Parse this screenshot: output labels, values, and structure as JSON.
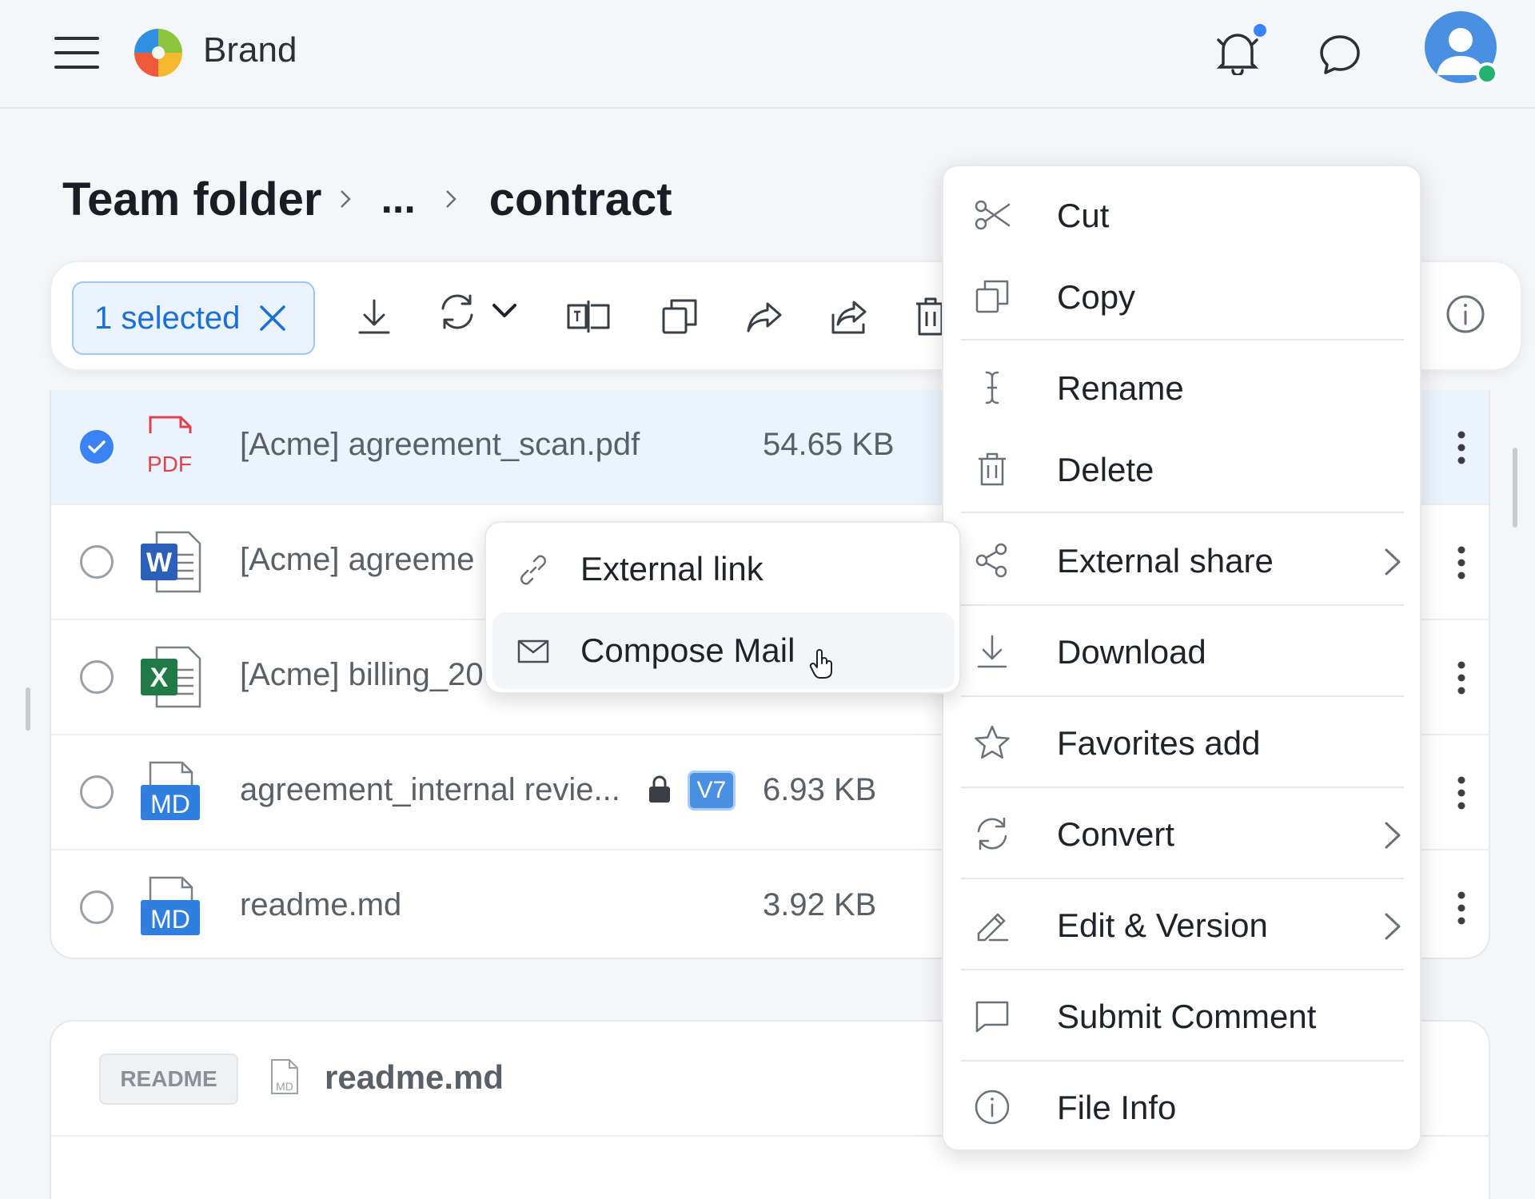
{
  "header": {
    "brand_name": "Brand",
    "icons": [
      "hamburger-menu-icon",
      "brand-logo",
      "bell-icon",
      "chat-icon",
      "user-avatar"
    ],
    "notification_dot_color": "#3b82f6",
    "online_status_color": "#22b46e"
  },
  "breadcrumb": {
    "root": "Team folder",
    "ellipsis": "...",
    "current": "contract"
  },
  "toolbar": {
    "selected_label": "1 selected",
    "accent_color": "#1a6fd8",
    "icons": [
      "download-icon",
      "convert-icon",
      "dropdown-chevron-icon",
      "rename-icon",
      "copy-icon",
      "share-icon",
      "external-share-icon",
      "delete-icon",
      "info-icon"
    ]
  },
  "files": [
    {
      "name": "[Acme] agreement_scan.pdf",
      "size": "54.65 KB",
      "type_label": "PDF",
      "selected": true
    },
    {
      "name": "[Acme] agreeme",
      "size": "",
      "type_label": "W",
      "selected": false
    },
    {
      "name": "[Acme] billing_20",
      "size": "",
      "type_label": "X",
      "selected": false
    },
    {
      "name": "agreement_internal revie...",
      "size": "6.93 KB",
      "type_label": "MD",
      "version": "V7",
      "locked": true,
      "selected": false
    },
    {
      "name": "readme.md",
      "size": "3.92 KB",
      "type_label": "MD",
      "selected": false
    }
  ],
  "readme": {
    "tag": "README",
    "file_icon_label": "MD",
    "file_name": "readme.md"
  },
  "context_menu": {
    "items": [
      {
        "label": "Cut",
        "icon": "scissors-icon"
      },
      {
        "label": "Copy",
        "icon": "copy-icon"
      },
      {
        "label": "Rename",
        "icon": "text-cursor-icon"
      },
      {
        "label": "Delete",
        "icon": "trash-icon"
      },
      {
        "label": "External share",
        "icon": "share-nodes-icon",
        "submenu": true
      },
      {
        "label": "Download",
        "icon": "download-icon"
      },
      {
        "label": "Favorites add",
        "icon": "star-icon"
      },
      {
        "label": "Convert",
        "icon": "convert-icon",
        "submenu": true
      },
      {
        "label": "Edit & Version",
        "icon": "pencil-icon",
        "submenu": true
      },
      {
        "label": "Submit Comment",
        "icon": "comment-icon"
      },
      {
        "label": "File Info",
        "icon": "info-icon"
      }
    ]
  },
  "submenu": {
    "items": [
      {
        "label": "External link",
        "icon": "link-icon"
      },
      {
        "label": "Compose Mail",
        "icon": "mail-icon",
        "hovered": true
      }
    ]
  }
}
